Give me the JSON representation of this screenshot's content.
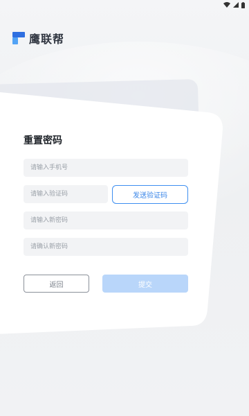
{
  "status_bar": {
    "icons": [
      "wifi-icon",
      "signal-icon",
      "battery-icon"
    ]
  },
  "brand": {
    "name": "鹰联帮",
    "icon": "logo-mark-icon",
    "accent_color": "#3a86e8"
  },
  "form": {
    "title": "重置密码",
    "phone_placeholder": "请输入手机号",
    "code_placeholder": "请输入验证码",
    "send_code_label": "发送验证码",
    "new_password_placeholder": "请输入新密码",
    "confirm_password_placeholder": "请确认新密码",
    "back_label": "返回",
    "submit_label": "提交"
  },
  "colors": {
    "primary": "#3a86e8",
    "submit_disabled_bg": "#b9d6fa",
    "field_bg": "#f2f3f5",
    "page_bg": "#f0f1f3"
  }
}
